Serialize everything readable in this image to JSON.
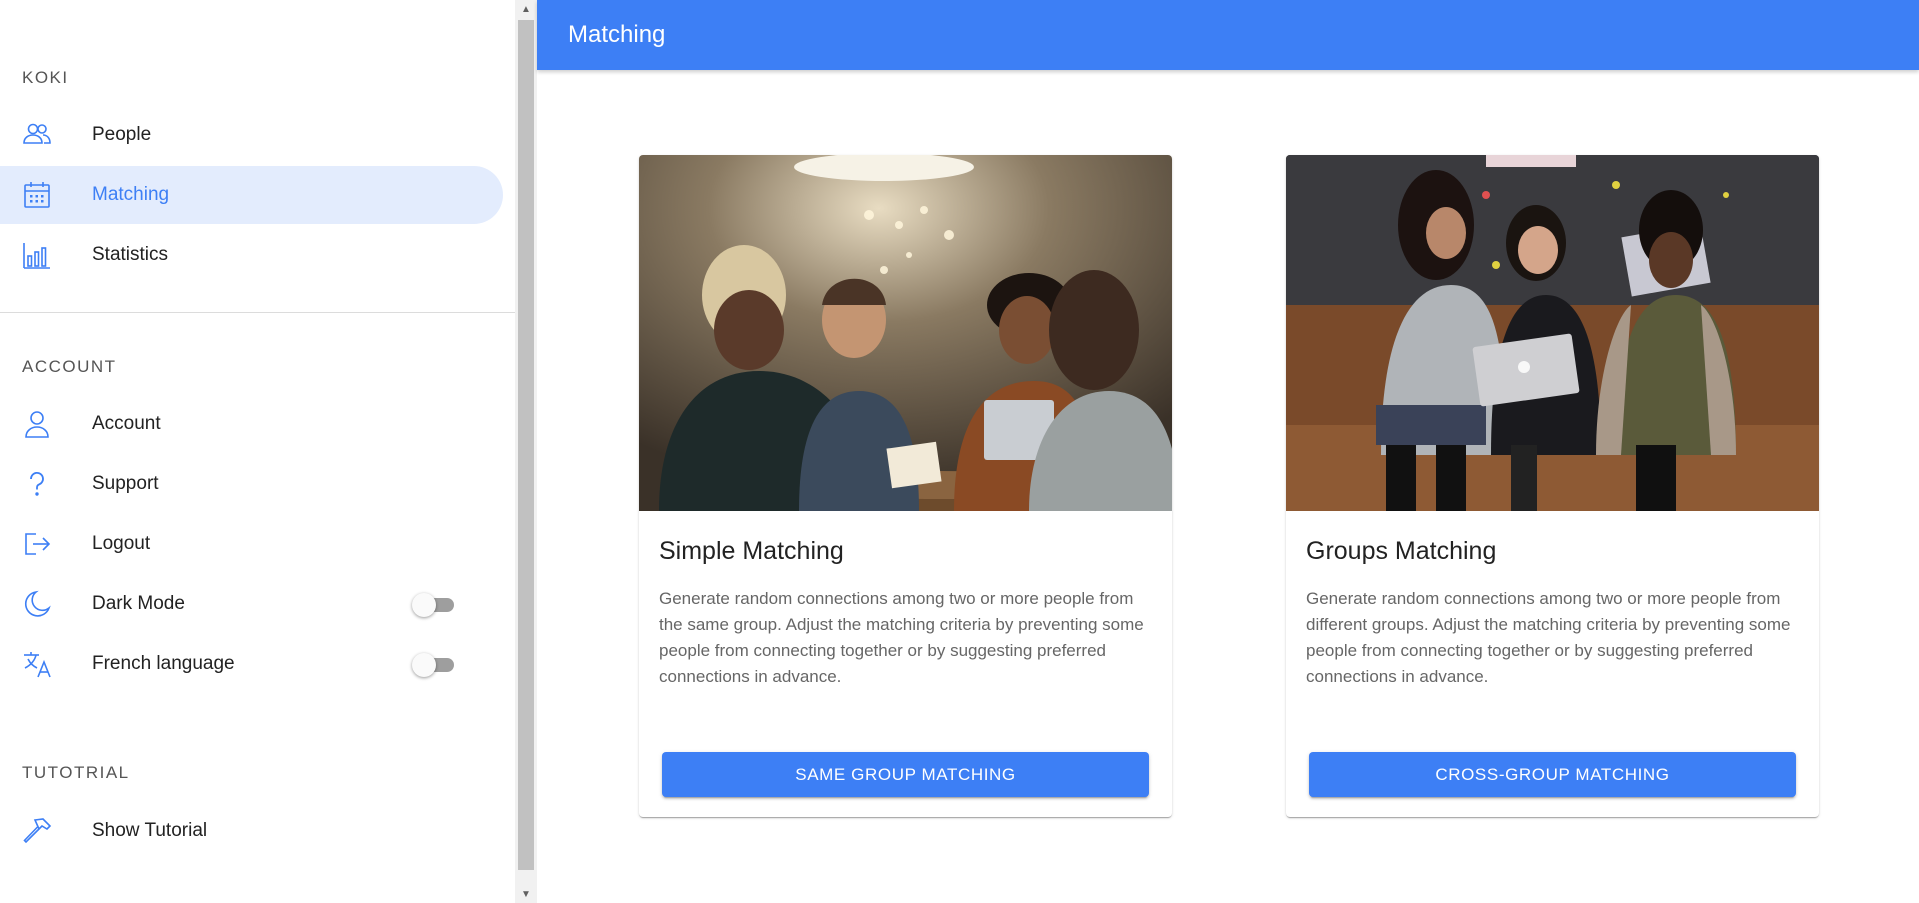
{
  "sidebar": {
    "sections": [
      {
        "title": "KOKI",
        "items": [
          {
            "label": "People",
            "icon": "people-icon",
            "active": false
          },
          {
            "label": "Matching",
            "icon": "calendar-icon",
            "active": true
          },
          {
            "label": "Statistics",
            "icon": "bar-chart-icon",
            "active": false
          }
        ]
      },
      {
        "title": "ACCOUNT",
        "items": [
          {
            "label": "Account",
            "icon": "person-icon"
          },
          {
            "label": "Support",
            "icon": "question-icon"
          },
          {
            "label": "Logout",
            "icon": "logout-icon"
          },
          {
            "label": "Dark Mode",
            "icon": "moon-icon",
            "toggle": false
          },
          {
            "label": "French language",
            "icon": "translate-icon",
            "toggle": false
          }
        ]
      },
      {
        "title": "TUTOTRIAL",
        "items": [
          {
            "label": "Show Tutorial",
            "icon": "hammer-icon"
          }
        ]
      }
    ]
  },
  "header": {
    "title": "Matching"
  },
  "cards": [
    {
      "title": "Simple Matching",
      "description": "Generate random connections among two or more people from the same group. Adjust the matching criteria by preventing some people from connecting together or by suggesting preferred connections in advance.",
      "button_label": "SAME GROUP MATCHING",
      "image": "photo of four people talking around a cafe table"
    },
    {
      "title": "Groups Matching",
      "description": "Generate random connections among two or more people from different groups. Adjust the matching criteria by preventing some people from connecting together or by suggesting preferred connections in advance.",
      "button_label": "CROSS-GROUP MATCHING",
      "image": "photo of three women sitting with a laptop"
    }
  ],
  "colors": {
    "primary": "#3d7ff5",
    "active_bg": "#e3ecfd"
  }
}
